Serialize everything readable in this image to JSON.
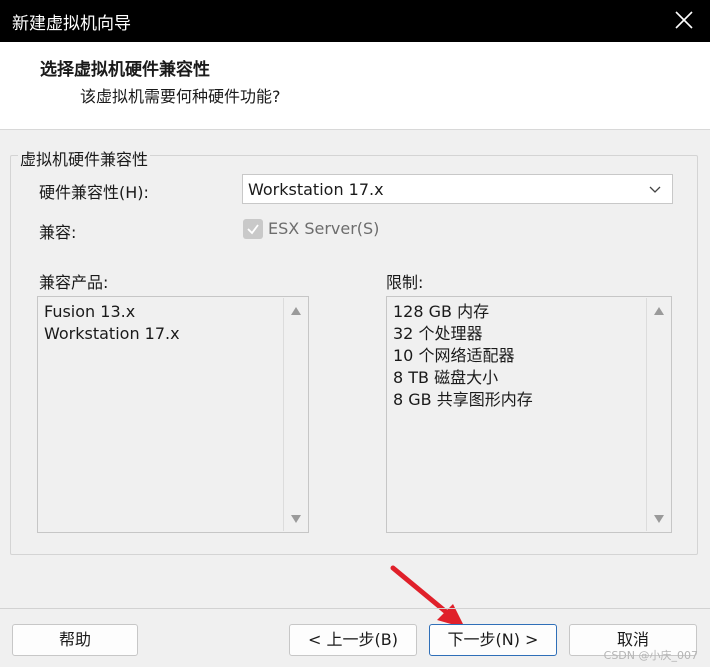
{
  "window": {
    "title": "新建虚拟机向导"
  },
  "header": {
    "title": "选择虚拟机硬件兼容性",
    "subtitle": "该虚拟机需要何种硬件功能?"
  },
  "group": {
    "legend": "虚拟机硬件兼容性",
    "hardware_label": "硬件兼容性(H):",
    "hardware_value": "Workstation 17.x",
    "compat_label": "兼容:",
    "esx_label": "ESX Server(S)",
    "esx_checked": true,
    "esx_enabled": false,
    "products_label": "兼容产品:",
    "products": [
      "Fusion 13.x",
      "Workstation 17.x"
    ],
    "limits_label": "限制:",
    "limits": [
      "128 GB 内存",
      "32 个处理器",
      "10 个网络适配器",
      "8 TB 磁盘大小",
      "8 GB 共享图形内存"
    ]
  },
  "footer": {
    "help": "帮助",
    "back": "< 上一步(B)",
    "next": "下一步(N) >",
    "cancel": "取消"
  },
  "watermark": "CSDN @小庆_007",
  "colors": {
    "titlebar": "#000000",
    "accent_border": "#2f6fb8",
    "annotation_arrow": "#e0202a"
  },
  "icons": {
    "close": "close-icon",
    "dropdown": "chevron-down-icon",
    "check": "check-icon",
    "scroll_up": "scroll-up-arrow-icon",
    "scroll_down": "scroll-down-arrow-icon",
    "annotation": "red-arrow-annotation"
  }
}
